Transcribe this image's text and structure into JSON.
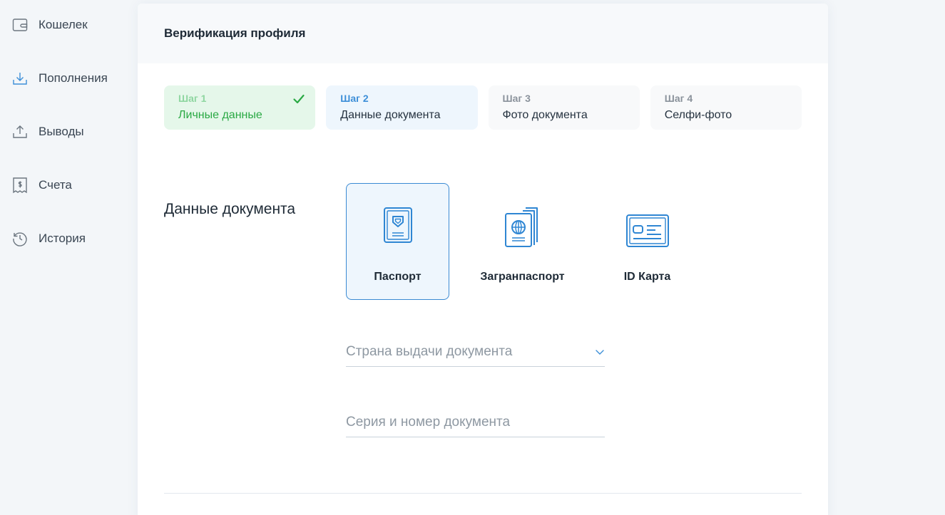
{
  "sidebar": {
    "items": [
      {
        "label": "Кошелек",
        "icon": "wallet-icon"
      },
      {
        "label": "Пополнения",
        "icon": "download-icon"
      },
      {
        "label": "Выводы",
        "icon": "upload-icon"
      },
      {
        "label": "Счета",
        "icon": "invoice-icon"
      },
      {
        "label": "История",
        "icon": "history-icon"
      }
    ]
  },
  "card": {
    "title": "Верификация профиля"
  },
  "steps": [
    {
      "num": "Шаг 1",
      "name": "Личные данные",
      "state": "done"
    },
    {
      "num": "Шаг 2",
      "name": "Данные документа",
      "state": "active"
    },
    {
      "num": "Шаг 3",
      "name": "Фото документа",
      "state": "pending"
    },
    {
      "num": "Шаг 4",
      "name": "Селфи-фото",
      "state": "pending"
    }
  ],
  "document": {
    "section_label": "Данные документа",
    "options": [
      {
        "label": "Паспорт",
        "icon": "passport-icon",
        "selected": true
      },
      {
        "label": "Загранпаспорт",
        "icon": "international-passport-icon",
        "selected": false
      },
      {
        "label": "ID Карта",
        "icon": "id-card-icon",
        "selected": false
      }
    ],
    "country_placeholder": "Страна выдачи документа",
    "number_placeholder": "Серия и номер документа"
  },
  "colors": {
    "accent": "#3a8ad3",
    "success": "#2aa944",
    "text": "#1e2a36"
  }
}
